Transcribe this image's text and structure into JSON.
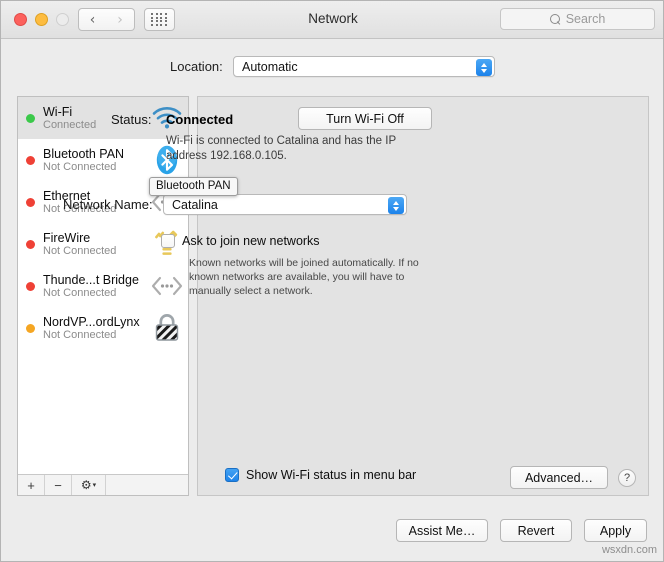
{
  "window": {
    "title": "Network",
    "traffic_lights": [
      "close",
      "minimize",
      "zoom"
    ]
  },
  "toolbar": {
    "back_icon": "chevron-left-icon",
    "forward_icon": "chevron-right-icon",
    "grid_icon": "show-all-grid-icon",
    "search_placeholder": "Search",
    "search_value": "",
    "search_icon": "search-icon"
  },
  "location": {
    "label": "Location:",
    "value": "Automatic"
  },
  "sidebar": {
    "services": [
      {
        "name": "Wi-Fi",
        "status": "Connected",
        "dot_color": "#3bc94a",
        "icon": "wifi-icon",
        "selected": true
      },
      {
        "name": "Bluetooth PAN",
        "status": "Not Connected",
        "dot_color": "#ef4136",
        "icon": "bluetooth-icon",
        "selected": false
      },
      {
        "name": "Ethernet",
        "status": "Not Connected",
        "dot_color": "#ef4136",
        "icon": "ethernet-icon",
        "selected": false
      },
      {
        "name": "FireWire",
        "status": "Not Connected",
        "dot_color": "#ef4136",
        "icon": "firewire-icon",
        "selected": false
      },
      {
        "name": "Thunde...t Bridge",
        "status": "Not Connected",
        "dot_color": "#ef4136",
        "icon": "thunderbolt-bridge-icon",
        "selected": false
      },
      {
        "name": "NordVP...ordLynx",
        "status": "Not Connected",
        "dot_color": "#f5a623",
        "icon": "vpn-lock-icon",
        "selected": false
      }
    ],
    "footer": {
      "add_label": "+",
      "remove_label": "−",
      "gear_label": "⚙",
      "gear_chevron": "▾"
    }
  },
  "tooltip": {
    "text": "Bluetooth PAN"
  },
  "panel": {
    "status_label": "Status:",
    "status_value": "Connected",
    "status_description": "Wi-Fi is connected to Catalina and has the IP address 192.168.0.105.",
    "turn_off_button": "Turn Wi-Fi Off",
    "network_name_label": "Network Name:",
    "network_name_value": "Catalina",
    "ask_join_label": "Ask to join new networks",
    "ask_join_checked": false,
    "ask_join_description": "Known networks will be joined automatically. If no known networks are available, you will have to manually select a network.",
    "show_status_label": "Show Wi-Fi status in menu bar",
    "show_status_checked": true,
    "advanced_button": "Advanced…",
    "help_button": "?"
  },
  "footer": {
    "assist_button": "Assist Me…",
    "revert_button": "Revert",
    "apply_button": "Apply"
  },
  "watermark": "wsxdn.com",
  "colors": {
    "accent_blue": "#1d83ea",
    "connected_green": "#3bc94a",
    "disconnected_red": "#ef4136",
    "pending_orange": "#f5a623",
    "panel_bg": "#e3e3e3",
    "window_bg": "#ececec"
  }
}
